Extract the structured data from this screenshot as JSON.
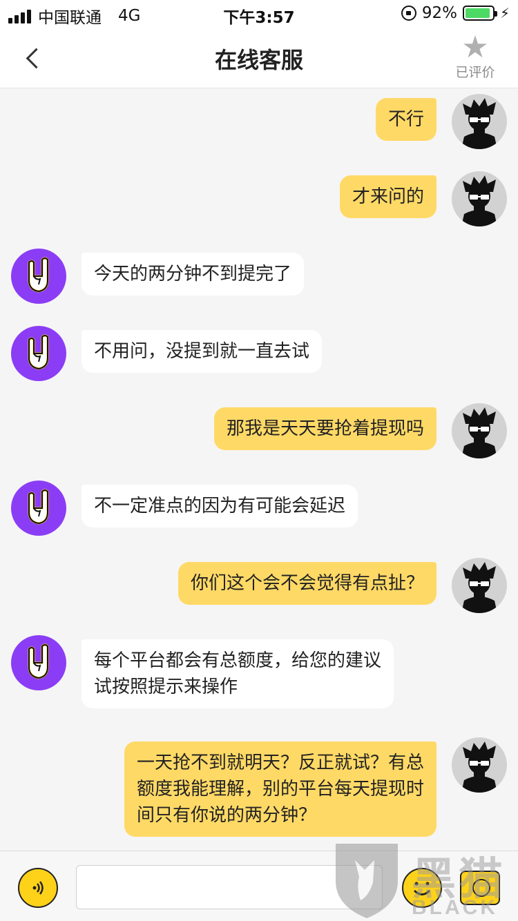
{
  "status_bar": {
    "carrier": "中国联通",
    "network": "4G",
    "time": "下午3:57",
    "battery_pct": "92%",
    "battery_level": 0.92
  },
  "nav": {
    "title": "在线客服",
    "rate_label": "已评价"
  },
  "messages": [
    {
      "from": "user",
      "text": "不行"
    },
    {
      "from": "user",
      "text": "才来问的"
    },
    {
      "from": "agent",
      "text": "今天的两分钟不到提完了"
    },
    {
      "from": "agent",
      "text": "不用问，没提到就一直去试"
    },
    {
      "from": "user",
      "text": "那我是天天要抢着提现吗"
    },
    {
      "from": "agent",
      "text": "不一定准点的因为有可能会延迟"
    },
    {
      "from": "user",
      "text": "你们这个会不会觉得有点扯？"
    },
    {
      "from": "agent",
      "text": "每个平台都会有总额度，给您的建议\n试按照提示来操作"
    },
    {
      "from": "user",
      "text": "一天抢不到就明天？反正就试？有总\n额度我能理解，别的平台每天提现时\n间只有你说的两分钟？"
    }
  ],
  "input_bar": {
    "placeholder": ""
  },
  "watermark": {
    "text": "黑猫",
    "sub": "BLACK CAT"
  },
  "colors": {
    "user_bubble": "#ffd966",
    "agent_bubble": "#ffffff",
    "agent_avatar": "#8b3df5",
    "accent": "#ffd21a"
  },
  "icons": {
    "back": "chevron-left-icon",
    "rate": "star-icon",
    "voice": "voice-icon",
    "emoji": "emoji-icon",
    "camera": "camera-icon"
  }
}
